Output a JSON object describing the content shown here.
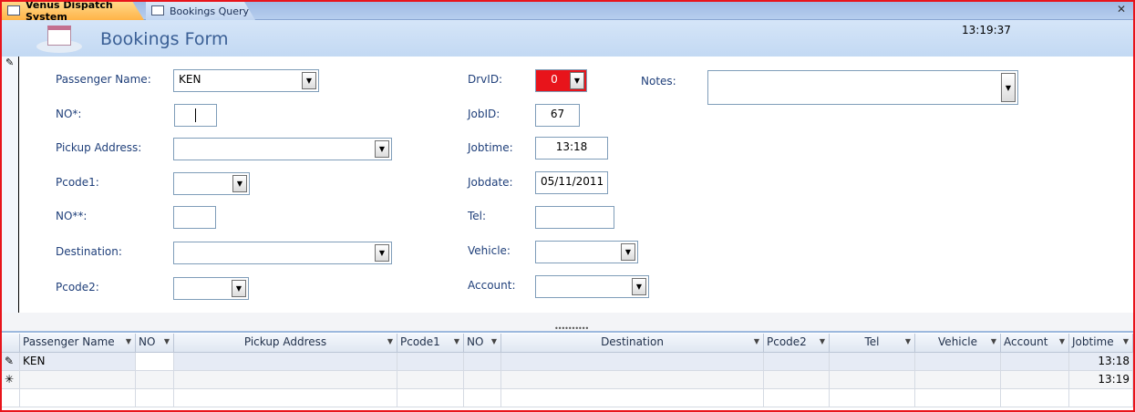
{
  "tabs": [
    {
      "label": "Venus Dispatch System",
      "active": true
    },
    {
      "label": "Bookings Query",
      "active": false
    }
  ],
  "header": {
    "title": "Bookings Form",
    "clock": "13:19:37"
  },
  "form": {
    "passenger_name": {
      "label": "Passenger Name:",
      "value": "KEN"
    },
    "no1": {
      "label": "NO*:",
      "value": ""
    },
    "pickup_address": {
      "label": "Pickup Address:",
      "value": ""
    },
    "pcode1": {
      "label": "Pcode1:",
      "value": ""
    },
    "no2": {
      "label": "NO**:",
      "value": ""
    },
    "destination": {
      "label": "Destination:",
      "value": ""
    },
    "pcode2": {
      "label": "Pcode2:",
      "value": ""
    },
    "drvid": {
      "label": "DrvID:",
      "value": "0",
      "color": "#e8141b"
    },
    "jobid": {
      "label": "JobID:",
      "value": "67"
    },
    "jobtime": {
      "label": "Jobtime:",
      "value": "13:18"
    },
    "jobdate": {
      "label": "Jobdate:",
      "value": "05/11/2011"
    },
    "tel": {
      "label": "Tel:",
      "value": ""
    },
    "vehicle": {
      "label": "Vehicle:",
      "value": ""
    },
    "account": {
      "label": "Account:",
      "value": ""
    },
    "notes": {
      "label": "Notes:",
      "value": ""
    }
  },
  "datasheet": {
    "columns": [
      "Passenger Name",
      "NO",
      "Pickup Address",
      "Pcode1",
      "NO",
      "Destination",
      "Pcode2",
      "Tel",
      "Vehicle",
      "Account",
      "Jobtime"
    ],
    "rows": [
      {
        "selector": "✎",
        "cells": [
          "KEN",
          "",
          "",
          "",
          "",
          "",
          "",
          "",
          "",
          "",
          "13:18"
        ]
      },
      {
        "selector": "✳",
        "cells": [
          "",
          "",
          "",
          "",
          "",
          "",
          "",
          "",
          "",
          "",
          "13:19"
        ]
      }
    ]
  }
}
